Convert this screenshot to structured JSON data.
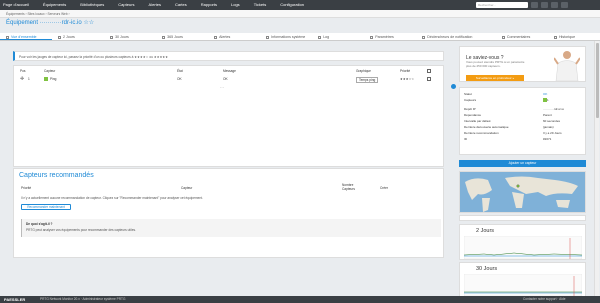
{
  "nav": {
    "items": [
      "Page d'accueil",
      "Équipements",
      "Bibliothèques",
      "Capteurs",
      "Alertes",
      "Cartes",
      "Rapports",
      "Logs",
      "Tickets",
      "Configuration"
    ],
    "search_placeholder": "Rechercher..."
  },
  "breadcrumb": "Équipements  ›  Sites locaux  ›  Serveurs Web  ›",
  "device_title": "Équipement ···········rdr-ic.io ☆☆",
  "tabs": [
    "Vue d'ensemble",
    "2 Jours",
    "30 Jours",
    "365 Jours",
    "Alertes",
    "Informations système",
    "Log",
    "Paramètres",
    "Déclencheurs de notification",
    "Commentaires",
    "Historique"
  ],
  "info_text": "Pour voir les jauges de capteur ici, passez la priorité d'un ou plusieurs capteurs à ★★★★☆ ou ★★★★★",
  "sensor_table": {
    "headers": [
      "Pos",
      "Capteur",
      "État",
      "Message",
      "Graphique",
      "Priorité"
    ],
    "rows": [
      {
        "pos": "1",
        "name": "Ping",
        "status": "OK",
        "message": "OK",
        "graph": "Temps ping",
        "priority": "★★★☆☆"
      }
    ]
  },
  "recommend": {
    "title": "Capteurs recommandés",
    "columns": [
      "Priorité",
      "Capteur",
      "Nombre Capteurs",
      "Créer"
    ],
    "empty_text": "Il n'y a actuellement aucune recommandation de capteur. Cliquez sur \"Recommander maintenant\" pour analyser cet équipement.",
    "button": "Recommander maintenant",
    "help_title": "De quoi s'agit-il ?",
    "help_text": "PRTG peut analyser vos équipements pour recommander des capteurs utiles."
  },
  "promo": {
    "title": "Le saviez-vous ?",
    "text": "Vous pouvez étendre PRTG à un paramètre plus de 250 000 capteurs.",
    "button": "Surveillance en profondeur »"
  },
  "details": [
    {
      "label": "Statut",
      "value": "OK"
    },
    {
      "label": "Capteurs",
      "value": "1"
    },
    {
      "label": "Dépôt IP",
      "value": "···········rdr-ic.io"
    },
    {
      "label": "Dépendance",
      "value": "Parent"
    },
    {
      "label": "Intervalle par défaut",
      "value": "60 secondes"
    },
    {
      "label": "Dernière découverte automatique",
      "value": "(jamais)"
    },
    {
      "label": "Dernière recommandation",
      "value": "Il y a 29 Jours"
    },
    {
      "label": "ID",
      "value": "#2071"
    }
  ],
  "add_sensor_button": "Ajouter un capteur",
  "graphs": [
    {
      "title": "2 Jours"
    },
    {
      "title": "30 Jours"
    }
  ],
  "footer": {
    "logo": "PAESSLER",
    "info": "PRTG Network Monitor 20.x · Administrateur système PRTG",
    "right": "Contacter notre support  ·  Aide"
  },
  "colors": {
    "accent": "#1f8ad6",
    "ok": "#7fc241",
    "topbar": "#3a3f44",
    "promo_button": "#f39c12"
  }
}
